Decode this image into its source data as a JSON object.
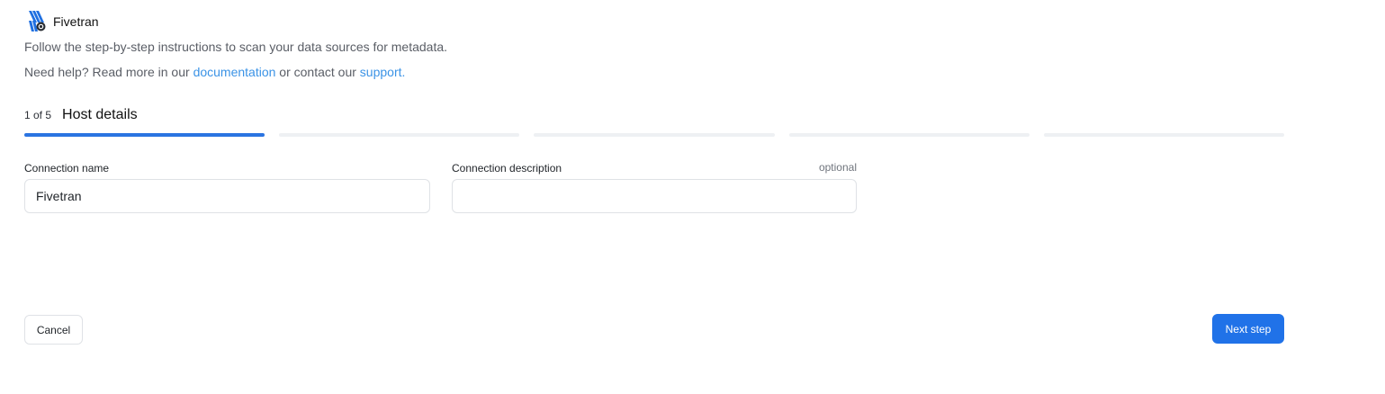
{
  "header": {
    "title": "Fivetran",
    "logo_icon": "fivetran-logo-icon"
  },
  "intro": {
    "text": "Follow the step-by-step instructions to scan your data sources for metadata."
  },
  "help": {
    "prefix": "Need help? Read more in our ",
    "documentation_link": "documentation",
    "middle": " or contact our ",
    "support_link": "support."
  },
  "stepper": {
    "count": "1 of 5",
    "title": "Host details",
    "current_step": 1,
    "total_steps": 5
  },
  "form": {
    "connection_name": {
      "label": "Connection name",
      "value": "Fivetran",
      "placeholder": ""
    },
    "connection_description": {
      "label": "Connection description",
      "optional_label": "optional",
      "value": "",
      "placeholder": ""
    }
  },
  "actions": {
    "cancel_label": "Cancel",
    "next_label": "Next step"
  },
  "colors": {
    "accent": "#2072e8",
    "link": "#3b93e6",
    "progress_inactive": "#eef0f3"
  }
}
